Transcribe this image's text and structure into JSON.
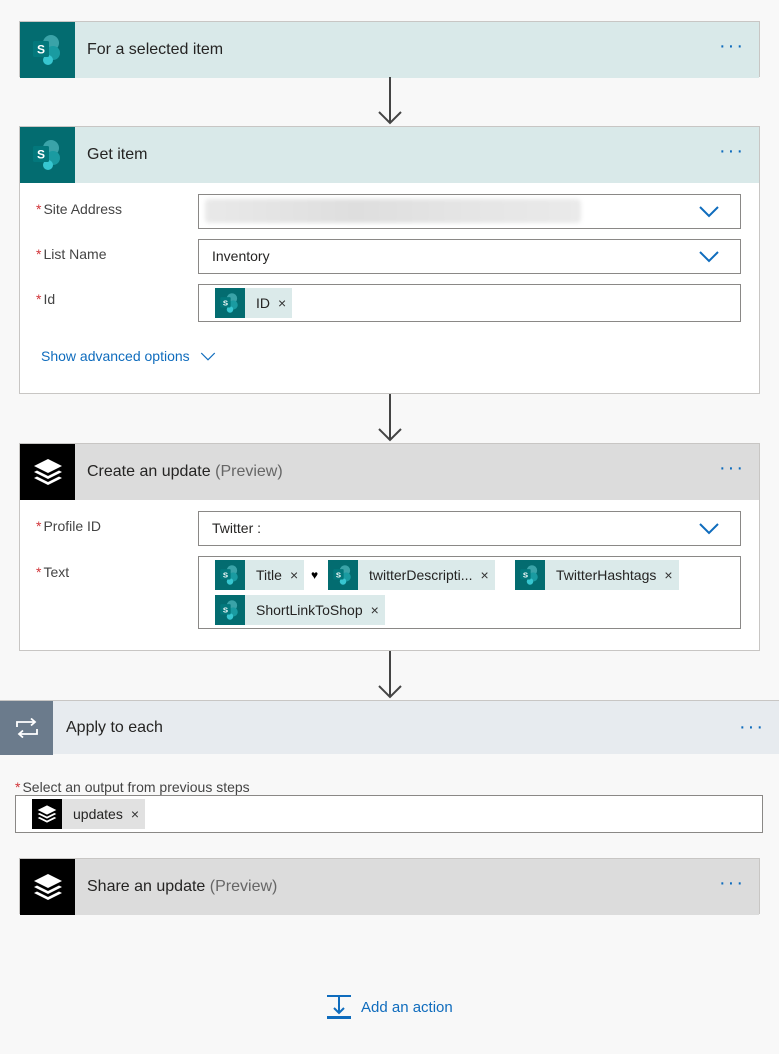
{
  "trigger": {
    "title": "For a selected item",
    "more": "···"
  },
  "get_item": {
    "title": "Get item",
    "more": "···",
    "fields": {
      "site_address": {
        "label": "Site Address",
        "value": ""
      },
      "list_name": {
        "label": "List Name",
        "value": "Inventory"
      },
      "id": {
        "label": "Id",
        "token": "ID"
      }
    },
    "show_advanced": "Show advanced options"
  },
  "create_update": {
    "title": "Create an update",
    "preview": "(Preview)",
    "more": "···",
    "fields": {
      "profile_id": {
        "label": "Profile ID",
        "value": "Twitter :"
      },
      "text": {
        "label": "Text",
        "tokens": [
          "Title",
          "twitterDescripti...",
          "TwitterHashtags",
          "ShortLinkToShop"
        ],
        "separator": "♥"
      }
    }
  },
  "apply_each": {
    "title": "Apply to each",
    "more": "···",
    "select_label": "Select an output from previous steps",
    "token": "updates"
  },
  "share_update": {
    "title": "Share an update",
    "preview": "(Preview)",
    "more": "···"
  },
  "add_action": {
    "label": "Add an action"
  },
  "required_mark": "*",
  "close_mark": "×",
  "icons": {
    "sharepoint": "sharepoint-icon",
    "buffer": "buffer-layers-icon",
    "loop": "loop-icon",
    "chevron": "chevron-down-icon",
    "add_action": "add-action-icon"
  },
  "colors": {
    "sharepoint": "#036c70",
    "link": "#0f6cbd",
    "required": "#d13438"
  }
}
